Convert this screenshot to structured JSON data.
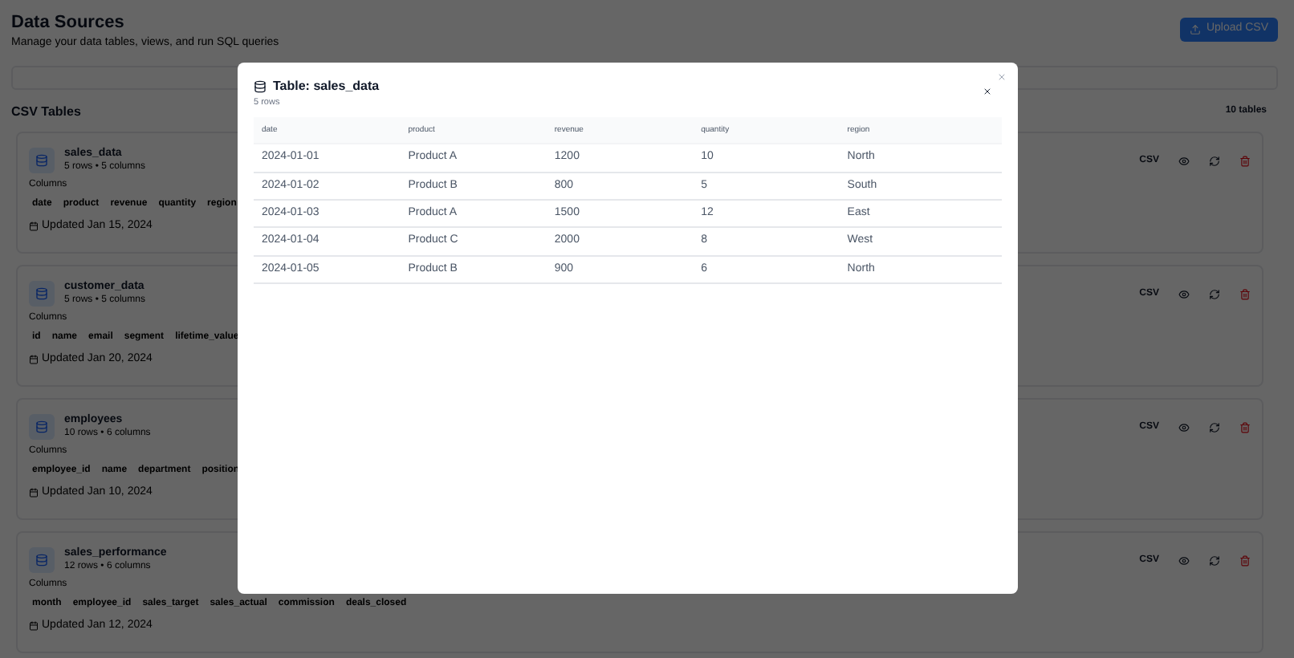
{
  "page": {
    "title": "Data Sources",
    "subtitle": "Manage your data tables, views, and run SQL queries",
    "upload_button": "Upload CSV"
  },
  "section": {
    "title": "CSV Tables",
    "count": "10 tables"
  },
  "tables": [
    {
      "name": "sales_data",
      "meta": "5 rows • 5 columns",
      "columns_label": "Columns",
      "columns": [
        "date",
        "product",
        "revenue",
        "quantity",
        "region"
      ],
      "updated": "Updated Jan 15, 2024",
      "format": "CSV"
    },
    {
      "name": "customer_data",
      "meta": "5 rows • 5 columns",
      "columns_label": "Columns",
      "columns": [
        "id",
        "name",
        "email",
        "segment",
        "lifetime_value"
      ],
      "updated": "Updated Jan 20, 2024",
      "format": "CSV"
    },
    {
      "name": "employees",
      "meta": "10 rows • 6 columns",
      "columns_label": "Columns",
      "columns": [
        "employee_id",
        "name",
        "department",
        "position"
      ],
      "updated": "Updated Jan 10, 2024",
      "format": "CSV"
    },
    {
      "name": "sales_performance",
      "meta": "12 rows • 6 columns",
      "columns_label": "Columns",
      "columns": [
        "month",
        "employee_id",
        "sales_target",
        "sales_actual",
        "commission",
        "deals_closed"
      ],
      "updated": "Updated Jan 12, 2024",
      "format": "CSV"
    }
  ],
  "dialog": {
    "title": "Table: sales_data",
    "subtitle": "5 rows",
    "columns": [
      "date",
      "product",
      "revenue",
      "quantity",
      "region"
    ],
    "rows": [
      [
        "2024-01-01",
        "Product A",
        "1200",
        "10",
        "North"
      ],
      [
        "2024-01-02",
        "Product B",
        "800",
        "5",
        "South"
      ],
      [
        "2024-01-03",
        "Product A",
        "1500",
        "12",
        "East"
      ],
      [
        "2024-01-04",
        "Product C",
        "2000",
        "8",
        "West"
      ],
      [
        "2024-01-05",
        "Product B",
        "900",
        "6",
        "North"
      ]
    ]
  }
}
